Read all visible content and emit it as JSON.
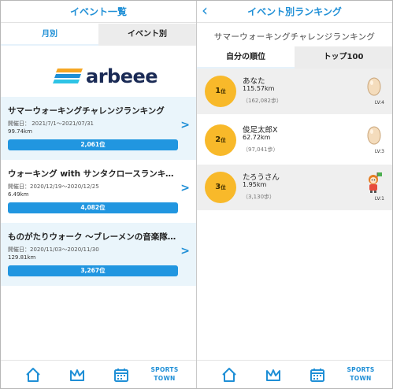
{
  "left": {
    "header_title": "イベント一覧",
    "tabs": [
      "月別",
      "イベント別"
    ],
    "logo_text": "arbeee",
    "events": [
      {
        "title": "サマーウォーキングチャレンジランキング",
        "date": "開催日： 2021/7/1～2021/07/31",
        "distance": "99.74km",
        "rank": "2,061位"
      },
      {
        "title": "ウォーキング with サンタクロースランキング",
        "date": "開催日：2020/12/19～2020/12/25",
        "distance": "6.49km",
        "rank": "4,082位"
      },
      {
        "title": "ものがたりウォーク ～ブレーメンの音楽隊～ランキング",
        "date": "開催日：2020/11/03～2020/11/30",
        "distance": "129.81km",
        "rank": "3,267位"
      }
    ]
  },
  "right": {
    "back_icon": "chevron-left-icon",
    "header_title": "イベント別ランキング",
    "event_title": "サマーウォーキングチャレンジランキング",
    "tabs": [
      "自分の順位",
      "トップ100"
    ],
    "rankings": [
      {
        "rank": "1",
        "rank_suffix": "位",
        "name": "あなた",
        "distance": "115.57km",
        "steps": "（162,082歩）",
        "level": "LV:4",
        "avatar": "egg-icon"
      },
      {
        "rank": "2",
        "rank_suffix": "位",
        "name": "俊足太郎X",
        "distance": "62.72km",
        "steps": "（97,041歩）",
        "level": "LV:3",
        "avatar": "egg-icon"
      },
      {
        "rank": "3",
        "rank_suffix": "位",
        "name": "たろうさん",
        "distance": "1.95km",
        "steps": "（3,130歩）",
        "level": "LV:1",
        "avatar": "character-icon"
      }
    ]
  },
  "footer": {
    "items": [
      "home-icon",
      "crown-icon",
      "calendar-icon"
    ],
    "brand_line1": "SPORTS",
    "brand_line2": "TOWN"
  },
  "colors": {
    "accent": "#1f8fd6",
    "bar": "#2196e0",
    "rank_circle": "#f8b92a",
    "card_bg": "#eaf5fb"
  }
}
